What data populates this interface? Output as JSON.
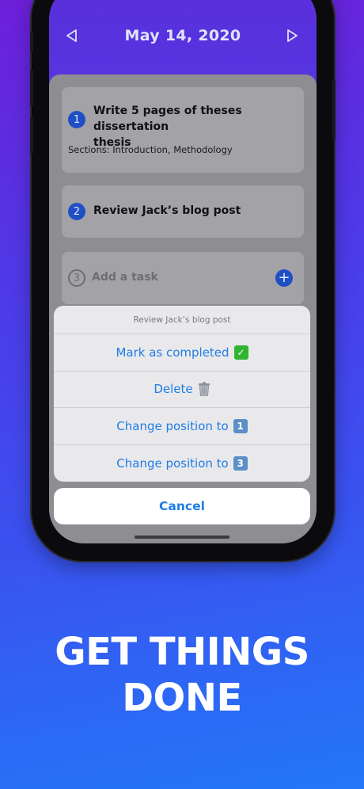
{
  "header": {
    "date": "May 14, 2020"
  },
  "tasks": [
    {
      "number": "1",
      "title_line1": "Write 5 pages of theses dissertation",
      "title_line2": "thesis",
      "sections": "Sections: Introduction, Methodology"
    },
    {
      "number": "2",
      "title": "Review Jack’s blog post"
    }
  ],
  "add_task": {
    "number": "3",
    "placeholder": "Add a task",
    "plus": "+"
  },
  "action_sheet": {
    "title": "Review Jack’s blog post",
    "options": [
      {
        "label": "Mark as completed",
        "badge": "✓"
      },
      {
        "label": "Delete"
      },
      {
        "label": "Change position to",
        "badge": "1"
      },
      {
        "label": "Change position to",
        "badge": "3"
      }
    ],
    "cancel": "Cancel"
  },
  "tagline": {
    "line1": "GET THINGS",
    "line2": "DONE"
  },
  "colors": {
    "accent": "#1f7ce6",
    "badge_blue": "#1f4fc4",
    "check_green": "#2fb52f"
  }
}
